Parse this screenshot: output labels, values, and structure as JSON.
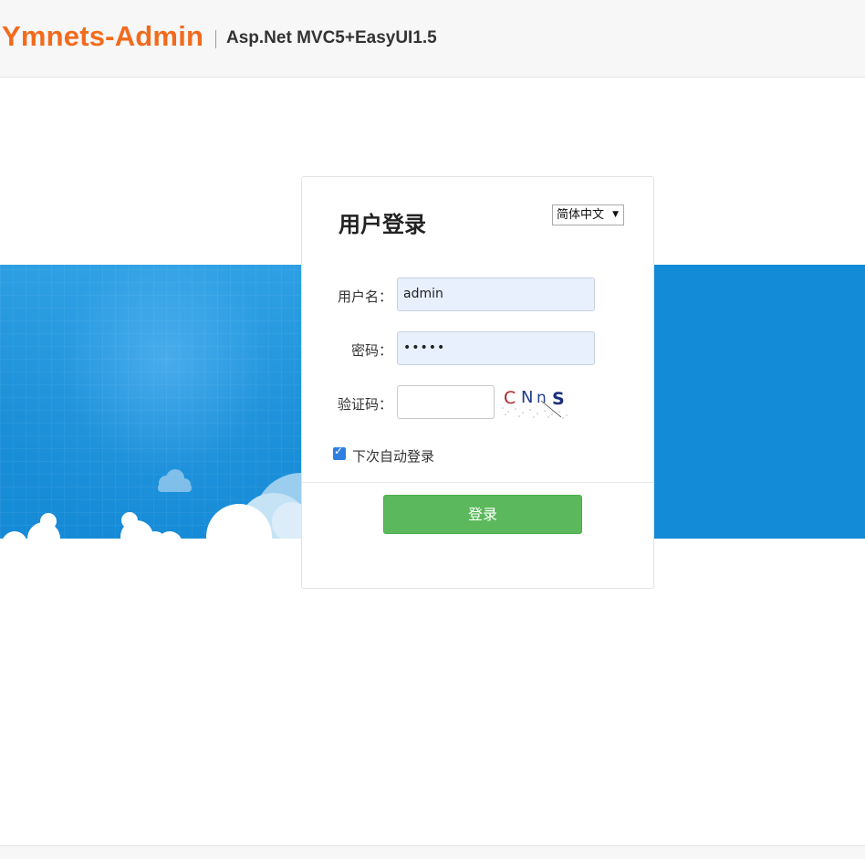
{
  "header": {
    "brand": "Ymnets-Admin",
    "subtitle": "Asp.Net MVC5+EasyUI1.5",
    "brand_color": "#f26b1d"
  },
  "login": {
    "title": "用户登录",
    "language": {
      "selected": "简体中文"
    },
    "username": {
      "label": "用户名：",
      "value": "admin"
    },
    "password": {
      "label": "密码：",
      "value": "•••••"
    },
    "captcha": {
      "label": "验证码：",
      "value": "",
      "image_text": "CNnS"
    },
    "remember": {
      "label": "下次自动登录",
      "checked": true
    },
    "submit_label": "登录",
    "submit_color": "#5cb85c"
  },
  "colors": {
    "banner": "#1b8fd8",
    "input_fill": "#e8f0fe"
  }
}
